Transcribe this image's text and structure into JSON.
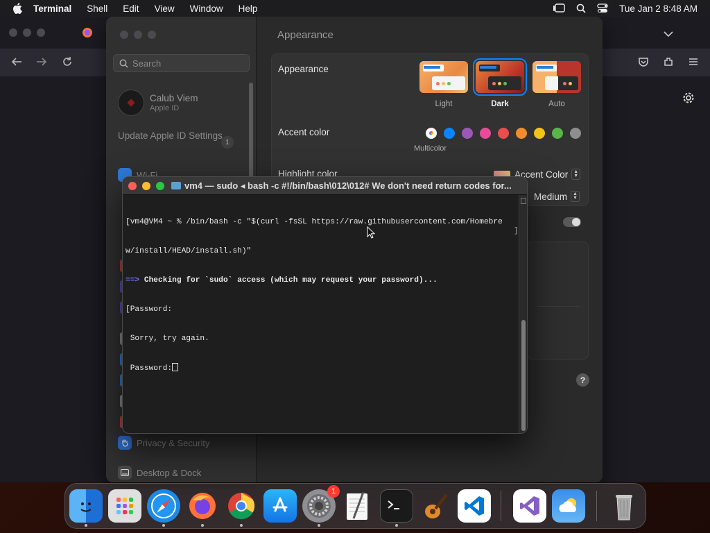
{
  "menubar": {
    "app_name": "Terminal",
    "items": [
      "Shell",
      "Edit",
      "View",
      "Window",
      "Help"
    ],
    "clock": "Tue Jan 2  8:48 AM"
  },
  "settings": {
    "search_placeholder": "Search",
    "account_name": "Calub Viem",
    "account_sub": "Apple ID",
    "update_label": "Update Apple ID Settings",
    "update_badge": "1",
    "wifi_label": "Wi-Fi",
    "privacy_label": "Privacy & Security",
    "desktop_label": "Desktop & Dock",
    "page_title": "Appearance",
    "appearance_label": "Appearance",
    "themes": [
      "Light",
      "Dark",
      "Auto"
    ],
    "selected_theme": "Dark",
    "accent_label": "Accent color",
    "accent_colors": [
      "multicolor",
      "#0a84ff",
      "#9b59b6",
      "#e94b9b",
      "#ea4d4d",
      "#f08c2a",
      "#f2c418",
      "#5ab54a",
      "#8e8e8e"
    ],
    "multicolor_label": "Multicolor",
    "highlight_label": "Highlight color",
    "highlight_value": "Accent Color",
    "sidebar_size_value": "Medium",
    "help_label": "?"
  },
  "terminal": {
    "title": "vm4 — sudo ◂ bash -c #!/bin/bash\\012\\012# We don't need return codes for...",
    "lines": {
      "l1": "[vm4@VM4 ~ % /bin/bash -c \"$(curl -fsSL https://raw.githubusercontent.com/Homebre",
      "l2": "w/install/HEAD/install.sh)\"",
      "l3_arrow": "==>",
      "l3_text": " Checking for `sudo` access (which may request your password)...",
      "l4": "[Password:",
      "l5": " Sorry, try again.",
      "l6": " Password:"
    }
  },
  "dock": {
    "apps": [
      "Finder",
      "Launchpad",
      "Safari",
      "Firefox",
      "Chrome",
      "App Store",
      "System Settings",
      "TextEdit",
      "Terminal",
      "GarageBand",
      "VS Code",
      "Visual Studio",
      "Weather",
      "Trash"
    ],
    "settings_badge": "1"
  }
}
